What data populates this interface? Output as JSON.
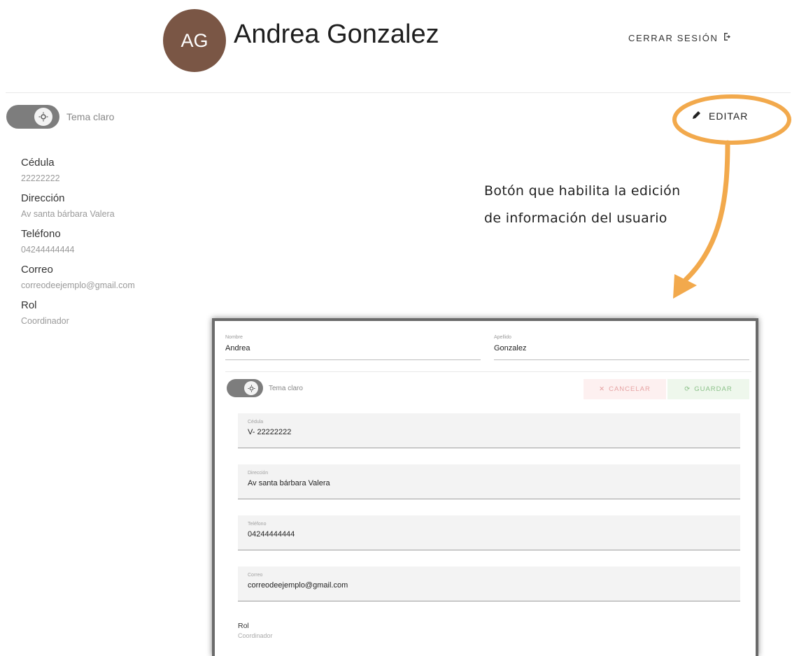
{
  "header": {
    "avatar_initials": "AG",
    "user_name": "Andrea Gonzalez",
    "logout_label": "CERRAR SESIÓN",
    "logout_icon": "logout-icon",
    "avatar_color": "#7a5645"
  },
  "theme_toggle": {
    "label": "Tema claro",
    "icon": "sun-icon"
  },
  "edit_button": {
    "label": "EDITAR",
    "icon": "pencil-icon"
  },
  "profile": {
    "items": [
      {
        "label": "Cédula",
        "value": "22222222"
      },
      {
        "label": "Dirección",
        "value": "Av santa bárbara Valera"
      },
      {
        "label": "Teléfono",
        "value": "04244444444"
      },
      {
        "label": "Correo",
        "value": "correodeejemplo@gmail.com"
      },
      {
        "label": "Rol",
        "value": "Coordinador"
      }
    ]
  },
  "annotation": {
    "line1": "Botón que habilita la edición",
    "line2": "de información del usuario",
    "color": "#f2a94c"
  },
  "edit_form": {
    "first_name": {
      "label": "Nombre",
      "value": "Andrea"
    },
    "last_name": {
      "label": "Apellido",
      "value": "Gonzalez"
    },
    "theme_label": "Tema claro",
    "cancel_label": "CANCELAR",
    "save_label": "GUARDAR",
    "fields": [
      {
        "label": "Cédula",
        "value": "V- 22222222"
      },
      {
        "label": "Dirección",
        "value": "Av santa bárbara Valera"
      },
      {
        "label": "Teléfono",
        "value": "04244444444"
      },
      {
        "label": "Correo",
        "value": "correodeejemplo@gmail.com"
      }
    ],
    "rol_label": "Rol",
    "rol_value": "Coordinador"
  }
}
